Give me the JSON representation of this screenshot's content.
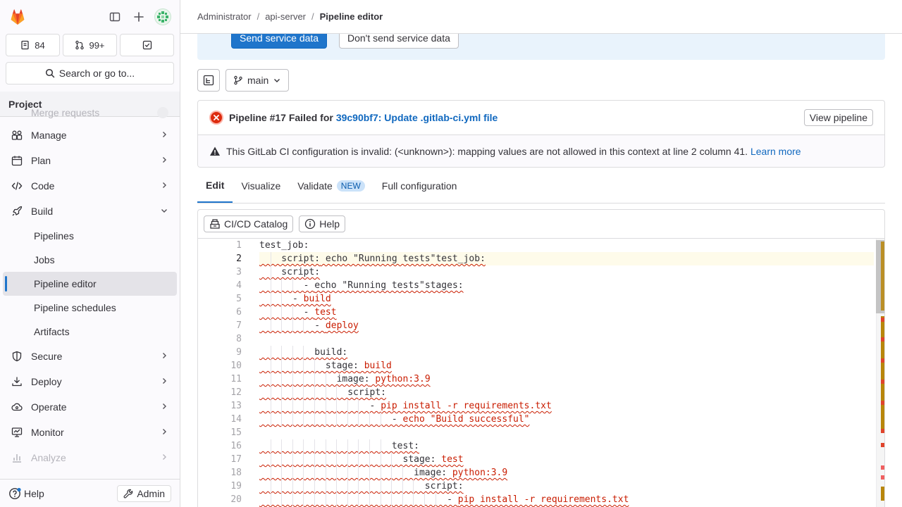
{
  "sidebar": {
    "counts": {
      "issues": "84",
      "merge_requests": "99+"
    },
    "search_label": "Search or go to...",
    "section_title": "Project",
    "faded_item": "Merge requests",
    "items": [
      {
        "label": "Manage",
        "icon": "users-icon"
      },
      {
        "label": "Plan",
        "icon": "calendar-icon"
      },
      {
        "label": "Code",
        "icon": "code-icon"
      },
      {
        "label": "Build",
        "icon": "rocket-icon"
      }
    ],
    "build_sub": [
      "Pipelines",
      "Jobs",
      "Pipeline editor",
      "Pipeline schedules",
      "Artifacts"
    ],
    "items_after": [
      {
        "label": "Secure",
        "icon": "shield-icon"
      },
      {
        "label": "Deploy",
        "icon": "deploy-icon"
      },
      {
        "label": "Operate",
        "icon": "cloud-icon"
      },
      {
        "label": "Monitor",
        "icon": "monitor-icon"
      },
      {
        "label": "Analyze",
        "icon": "chart-icon"
      }
    ],
    "help_label": "Help",
    "admin_label": "Admin"
  },
  "breadcrumb": {
    "a": "Administrator",
    "b": "api-server",
    "c": "Pipeline editor"
  },
  "banner": {
    "send": "Send service data",
    "dont_send": "Don't send service data"
  },
  "branch": {
    "name": "main"
  },
  "status": {
    "title": "Pipeline #17 Failed for",
    "commit": "39c90bf7: Update .gitlab-ci.yml file",
    "view_button": "View pipeline",
    "warning": "This GitLab CI configuration is invalid: (<unknown>): mapping values are not allowed in this context at line 2 column 41.",
    "learn_more": "Learn more"
  },
  "tabs": {
    "edit": "Edit",
    "visualize": "Visualize",
    "validate": "Validate",
    "validate_badge": "NEW",
    "full": "Full configuration"
  },
  "editor_toolbar": {
    "catalog": "CI/CD Catalog",
    "help": "Help"
  },
  "code": {
    "current_line": 2,
    "lines": [
      "test_job:",
      "    script: echo \"Running tests\"test_job:",
      "    script:",
      "        - echo \"Running tests\"stages:",
      "      - build",
      "        - test",
      "          - deploy",
      "",
      "          build:",
      "            stage: build",
      "              image: python:3.9",
      "                script:",
      "                    - pip install -r requirements.txt",
      "                        - echo \"Build successful\"",
      "",
      "                        test:",
      "                          stage: test",
      "                            image: python:3.9",
      "                              script:",
      "                                  - pip install -r requirements.txt"
    ]
  },
  "colors": {
    "primary": "#1f75cb",
    "danger": "#dd2b0e",
    "link": "#1068bf"
  }
}
